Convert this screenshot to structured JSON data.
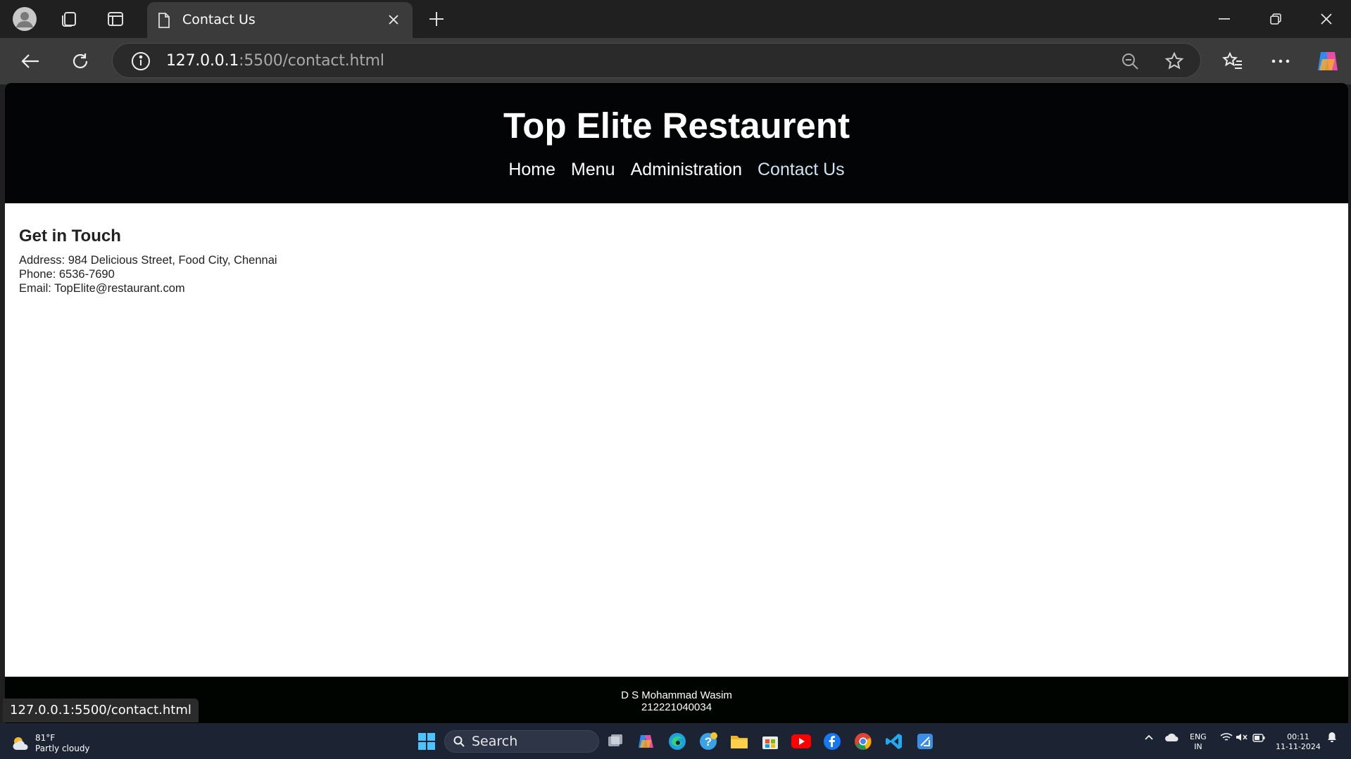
{
  "browser": {
    "tab": {
      "title": "Contact Us"
    },
    "address": {
      "host": "127.0.0.1",
      "path": ":5500/contact.html"
    },
    "status_url": "127.0.0.1:5500/contact.html"
  },
  "site": {
    "title": "Top Elite Restaurent",
    "nav": [
      {
        "label": "Home"
      },
      {
        "label": "Menu"
      },
      {
        "label": "Administration"
      },
      {
        "label": "Contact Us"
      }
    ],
    "contact": {
      "heading": "Get in Touch",
      "address": "Address: 984 Delicious Street, Food City, Chennai",
      "phone": "Phone: 6536-7690",
      "email": "Email: TopElite@restaurant.com"
    },
    "footer": {
      "name": "D S Mohammad Wasim",
      "id": "212221040034"
    }
  },
  "taskbar": {
    "weather": {
      "temp": "81°F",
      "desc": "Partly cloudy"
    },
    "search_label": "Search",
    "lang": {
      "top": "ENG",
      "bottom": "IN"
    },
    "clock": {
      "time": "00:11",
      "date": "11-11-2024"
    }
  },
  "colors": {
    "header_bg": "#020406",
    "active_nav": "#cfe2f0",
    "accent": "#0078d4"
  }
}
